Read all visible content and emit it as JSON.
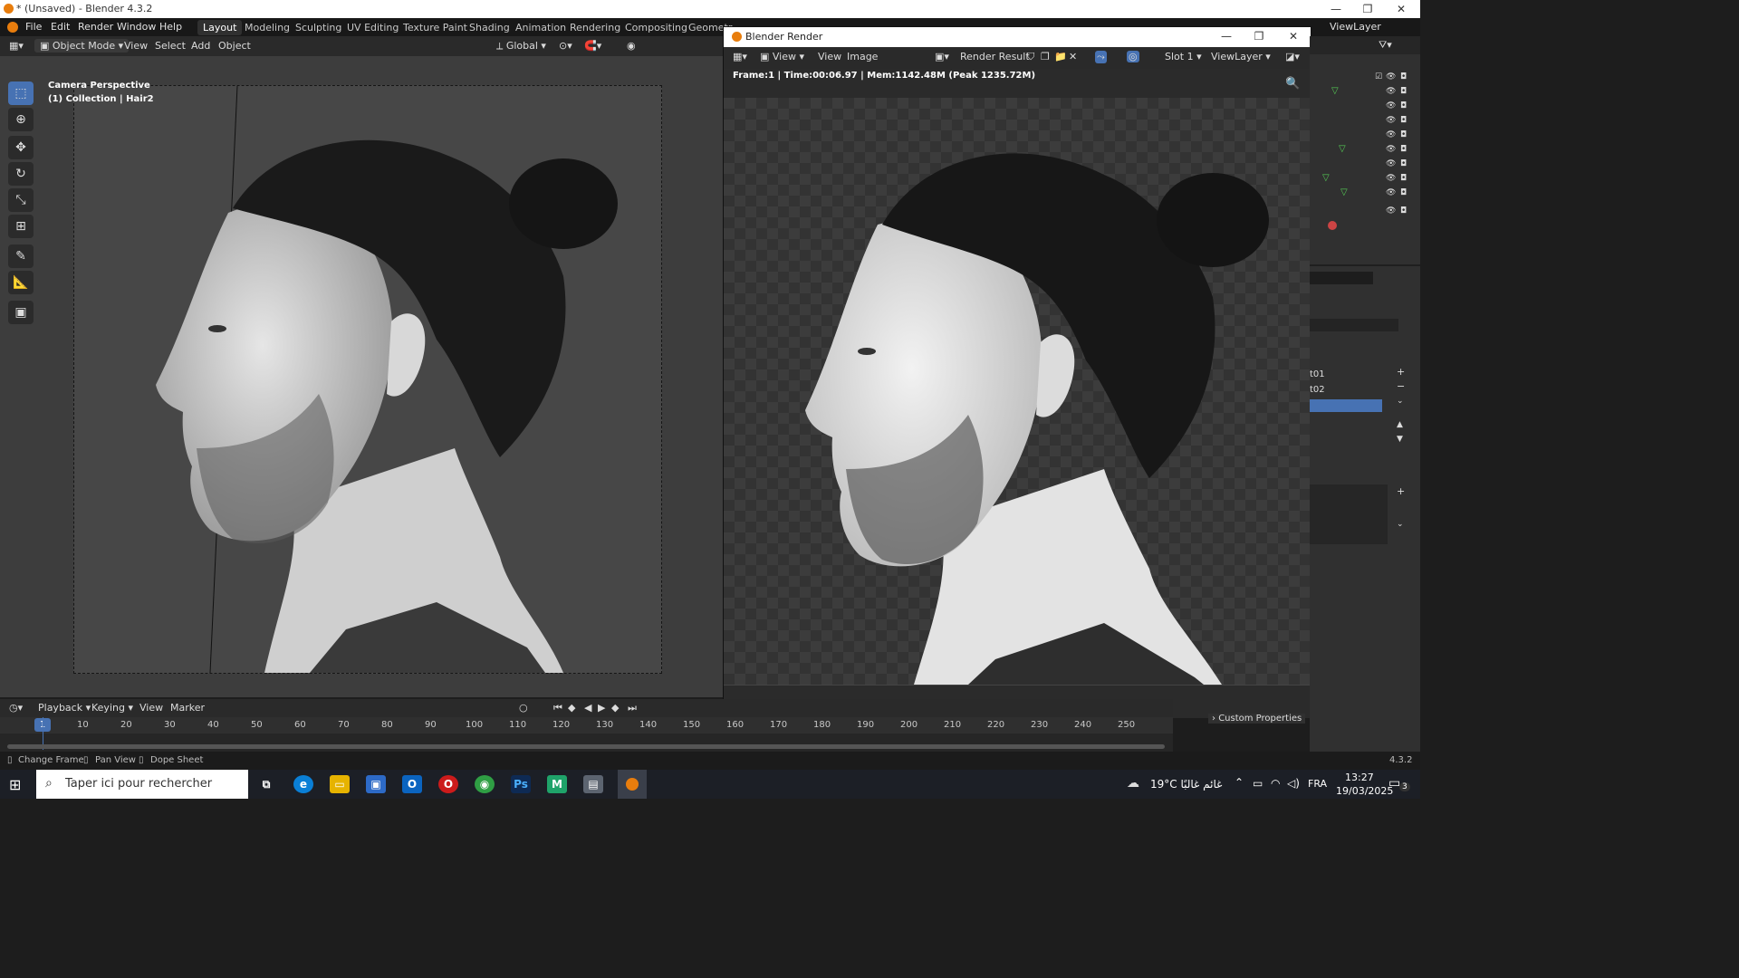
{
  "window": {
    "title": "* (Unsaved) - Blender 4.3.2",
    "minimize": "—",
    "maximize": "❐",
    "close": "✕"
  },
  "menu": {
    "items": [
      "File",
      "Edit",
      "Render",
      "Window",
      "Help"
    ]
  },
  "workspaces": {
    "tabs": [
      "Layout",
      "Modeling",
      "Sculpting",
      "UV Editing",
      "Texture Paint",
      "Shading",
      "Animation",
      "Rendering",
      "Compositing",
      "Geometr"
    ],
    "active": "Layout"
  },
  "viewport_header": {
    "mode": "Object Mode",
    "items": [
      "View",
      "Select",
      "Add",
      "Object"
    ],
    "transform": "Global"
  },
  "viewport": {
    "label_line1": "Camera Perspective",
    "label_line2": "(1) Collection | Hair2",
    "tools": [
      "select-box",
      "cursor",
      "move",
      "rotate",
      "scale",
      "transform",
      "annotate",
      "measure",
      "add-cube"
    ]
  },
  "render_window": {
    "title": "Blender Render",
    "header_items": [
      "View",
      "View",
      "Image"
    ],
    "result_label": "Render Result",
    "slot": "Slot 1",
    "view_layer": "ViewLayer",
    "info": "Frame:1 | Time:00:06.97 | Mem:1142.48M (Peak 1235.72M)"
  },
  "right_panel": {
    "view_layer": "ViewLayer",
    "uv_items": [
      "t01",
      "t02"
    ],
    "custom_properties": "Custom Properties"
  },
  "timeline": {
    "header_items": [
      "Playback",
      "Keying",
      "View",
      "Marker"
    ],
    "current_frame": "1",
    "ticks": [
      "10",
      "20",
      "30",
      "40",
      "50",
      "60",
      "70",
      "80",
      "90",
      "100",
      "110",
      "120",
      "130",
      "140",
      "150",
      "160",
      "170",
      "180",
      "190",
      "200",
      "210",
      "220",
      "230",
      "240",
      "250"
    ]
  },
  "status_bar": {
    "items": [
      "Change Frame",
      "Pan View",
      "Dope Sheet"
    ],
    "version": "4.3.2"
  },
  "taskbar": {
    "search_placeholder": "Taper ici pour rechercher",
    "weather": "19°C  غائم غالبًا",
    "language": "FRA",
    "time": "13:27",
    "date": "19/03/2025",
    "notification_count": "3"
  },
  "colors": {
    "accent": "#4772b3",
    "blender_orange": "#e87d0d",
    "frame_indicator": "#4772b3"
  }
}
